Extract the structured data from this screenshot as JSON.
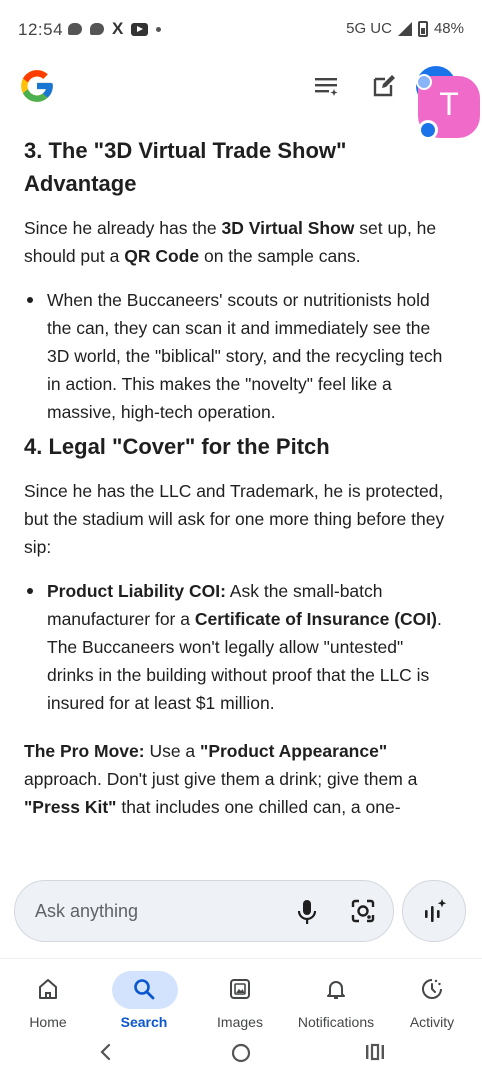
{
  "status": {
    "time": "12:54",
    "network": "5G UC",
    "battery": "48%"
  },
  "header": {
    "avatar_letter": "T"
  },
  "content": {
    "section3": {
      "title": "3. The \"3D Virtual Trade Show\" Advantage",
      "para": [
        "Since he already has the ",
        "3D Virtual Show",
        " set up, he should put a ",
        "QR Code",
        " on the sample cans."
      ],
      "bullet": "When the Buccaneers' scouts or nutritionists hold the can, they can scan it and immediately see the 3D world, the \"biblical\" story, and the recycling tech in action. This makes the \"novelty\" feel like a massive, high-tech operation."
    },
    "section4": {
      "title": "4. Legal \"Cover\" for the Pitch",
      "para": "Since he has the LLC and Trademark, he is protected, but the stadium will ask for one more thing before they sip:",
      "bullet": [
        "Product Liability COI:",
        " Ask the small-batch manufacturer for a ",
        "Certificate of Insurance (COI)",
        ". The Buccaneers won't legally allow \"untested\" drinks in the building without proof that the LLC is insured for at least $1 million."
      ]
    },
    "pro_move": [
      "The Pro Move:",
      " Use a ",
      "\"Product Appearance\"",
      " approach. Don't just give them a drink; give them a ",
      "\"Press Kit\"",
      " that includes one chilled can, a one-"
    ]
  },
  "ask": {
    "placeholder": "Ask anything"
  },
  "nav": {
    "items": [
      {
        "label": "Home",
        "icon": "home-icon"
      },
      {
        "label": "Search",
        "icon": "search-icon",
        "active": true
      },
      {
        "label": "Images",
        "icon": "images-icon"
      },
      {
        "label": "Notifications",
        "icon": "bell-icon"
      },
      {
        "label": "Activity",
        "icon": "activity-icon"
      }
    ]
  },
  "colors": {
    "accent": "#0b57d0",
    "pill": "#d3e3fd",
    "bubble": "#f06ac9"
  }
}
